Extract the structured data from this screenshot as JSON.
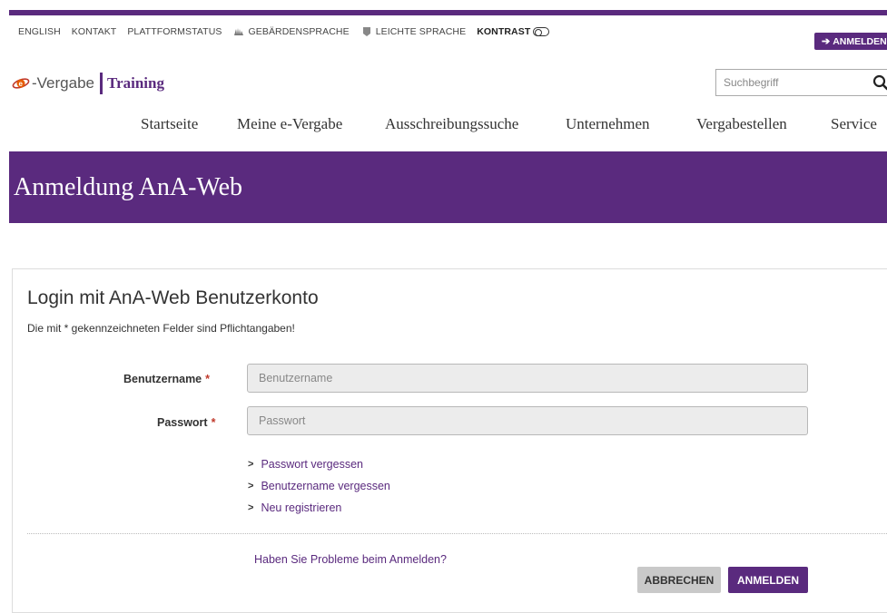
{
  "utility_nav": {
    "english": "ENGLISH",
    "contact": "KONTAKT",
    "status": "PLATTFORMSTATUS",
    "sign_language": "GEBÄRDENSPRACHE",
    "easy_language": "LEICHTE SPRACHE",
    "contrast": "KONTRAST"
  },
  "header": {
    "login_button": "ANMELDEN",
    "logo_text": "-Vergabe",
    "logo_training": "Training",
    "search_placeholder": "Suchbegriff"
  },
  "main_nav": [
    "Startseite",
    "Meine e-Vergabe",
    "Ausschreibungssuche",
    "Unternehmen",
    "Vergabestellen",
    "Service"
  ],
  "page": {
    "title": "Anmeldung AnA-Web"
  },
  "form": {
    "title": "Login mit AnA-Web Benutzerkonto",
    "required_note": "Die mit * gekennzeichneten Felder sind Pflichtangaben!",
    "username_label": "Benutzername",
    "username_placeholder": "Benutzername",
    "password_label": "Passwort",
    "password_placeholder": "Passwort",
    "required_mark": "*",
    "links": [
      "Passwort vergessen",
      "Benutzername vergessen",
      "Neu registrieren"
    ],
    "problem_link": "Haben Sie Probleme beim Anmelden?",
    "cancel_button": "ABBRECHEN",
    "submit_button": "ANMELDEN"
  },
  "colors": {
    "brand": "#5a2a7e",
    "required": "#c0392b"
  }
}
